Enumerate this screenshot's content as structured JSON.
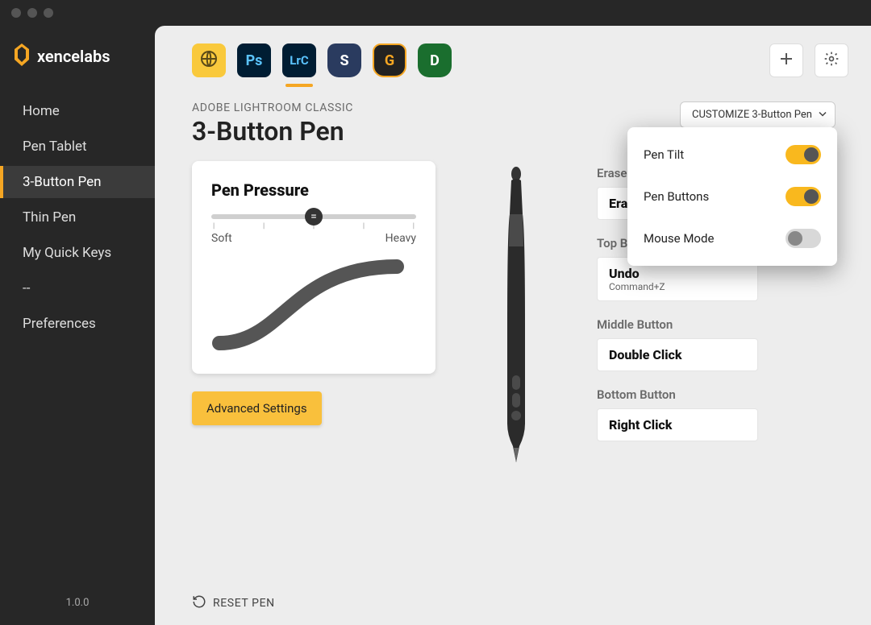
{
  "brand": {
    "name": "xencelabs"
  },
  "version": "1.0.0",
  "sidebar": {
    "items": [
      {
        "label": "Home"
      },
      {
        "label": "Pen Tablet"
      },
      {
        "label": "3-Button Pen"
      },
      {
        "label": "Thin Pen"
      },
      {
        "label": "My Quick Keys"
      },
      {
        "label": "--"
      },
      {
        "label": "Preferences"
      }
    ]
  },
  "toolbar": {
    "apps": [
      {
        "id": "globe",
        "label": ""
      },
      {
        "id": "ps",
        "label": "Ps"
      },
      {
        "id": "lrc",
        "label": "LrC"
      },
      {
        "id": "s",
        "label": "S"
      },
      {
        "id": "g",
        "label": "G"
      },
      {
        "id": "d",
        "label": "D"
      }
    ]
  },
  "header": {
    "crumb": "ADOBE LIGHTROOM CLASSIC",
    "title": "3-Button Pen",
    "customize_label": "CUSTOMIZE 3-Button Pen"
  },
  "pressure": {
    "heading": "Pen Pressure",
    "soft": "Soft",
    "heavy": "Heavy",
    "advanced": "Advanced Settings"
  },
  "right": {
    "eraser_label": "Eraser",
    "eraser_value": "Erase",
    "top_label": "Top Button",
    "top_value": "Undo",
    "top_sub": "Command+Z",
    "middle_label": "Middle Button",
    "middle_value": "Double Click",
    "bottom_label": "Bottom Button",
    "bottom_value": "Right Click"
  },
  "dropdown": {
    "items": [
      {
        "label": "Pen Tilt",
        "on": true
      },
      {
        "label": "Pen Buttons",
        "on": true
      },
      {
        "label": "Mouse Mode",
        "on": false
      }
    ]
  },
  "reset_label": "RESET PEN"
}
